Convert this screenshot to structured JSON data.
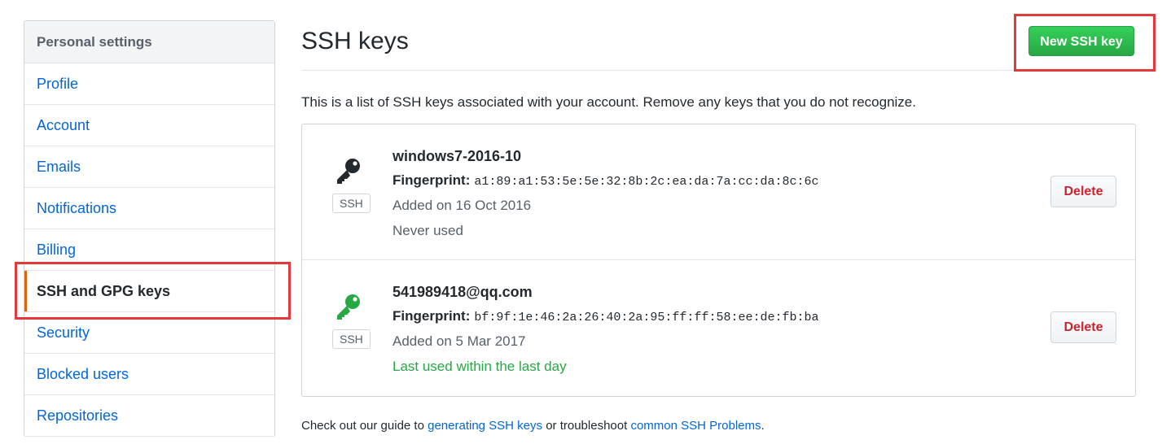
{
  "sidebar": {
    "header": "Personal settings",
    "items": [
      {
        "label": "Profile"
      },
      {
        "label": "Account"
      },
      {
        "label": "Emails"
      },
      {
        "label": "Notifications"
      },
      {
        "label": "Billing"
      },
      {
        "label": "SSH and GPG keys",
        "selected": true
      },
      {
        "label": "Security"
      },
      {
        "label": "Blocked users"
      },
      {
        "label": "Repositories"
      }
    ]
  },
  "main": {
    "title": "SSH keys",
    "new_key_button": "New SSH key",
    "intro": "This is a list of SSH keys associated with your account. Remove any keys that you do not recognize.",
    "keys": [
      {
        "title": "windows7-2016-10",
        "fingerprint_label": "Fingerprint:",
        "fingerprint": "a1:89:a1:53:5e:5e:32:8b:2c:ea:da:7a:cc:da:8c:6c",
        "added": "Added on 16 Oct 2016",
        "usage": "Never used",
        "type_label": "SSH",
        "icon": "key-icon",
        "icon_color": "#24292e",
        "delete_label": "Delete"
      },
      {
        "title": "541989418@qq.com",
        "fingerprint_label": "Fingerprint:",
        "fingerprint": "bf:9f:1e:46:2a:26:40:2a:95:ff:ff:58:ee:de:fb:ba",
        "added": "Added on 5 Mar 2017",
        "usage": "Last used within the last day",
        "type_label": "SSH",
        "icon": "key-icon",
        "icon_color": "#28a745",
        "delete_label": "Delete"
      }
    ],
    "footer": {
      "prefix": "Check out our guide to",
      "link1": "generating SSH keys",
      "middle": "or troubleshoot",
      "link2": "common SSH Problems",
      "suffix": "."
    }
  },
  "colors": {
    "link": "#0366d6",
    "active_marker": "#e36209",
    "primary_button": "#28a745",
    "danger_text": "#cb2431",
    "highlight_box": "#e5383b"
  }
}
